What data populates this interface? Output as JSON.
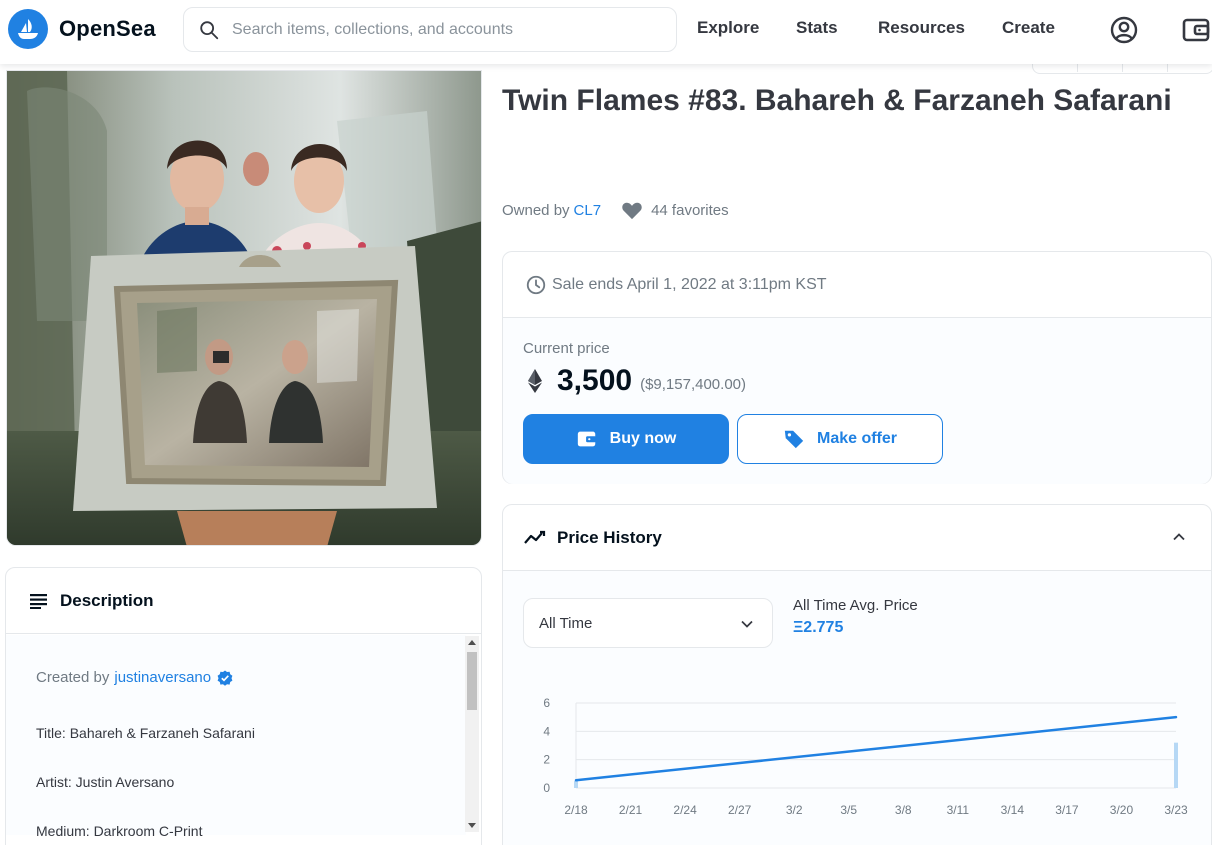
{
  "nav": {
    "brand": "OpenSea",
    "search_placeholder": "Search items, collections, and accounts",
    "links": [
      "Explore",
      "Stats",
      "Resources",
      "Create"
    ]
  },
  "item": {
    "title": "Twin Flames #83. Bahareh & Farzaneh Safarani",
    "owned_by_label": "Owned by",
    "owner": "CL7",
    "favorites": "44 favorites"
  },
  "sale": {
    "ends_text": "Sale ends April 1, 2022 at 3:11pm KST",
    "current_price_label": "Current price",
    "price": "3,500",
    "price_usd": "($9,157,400.00)",
    "buy_label": "Buy now",
    "offer_label": "Make offer"
  },
  "description": {
    "header": "Description",
    "created_by_label": "Created by",
    "creator": "justinaversano",
    "lines": [
      "Title: Bahareh & Farzaneh Safarani",
      "Artist: Justin Aversano",
      "Medium: Darkroom C-Print"
    ]
  },
  "price_history": {
    "header": "Price History",
    "range_selected": "All Time",
    "avg_label": "All Time Avg. Price",
    "avg_value": "Ξ2.775"
  },
  "chart_data": {
    "type": "line",
    "x": [
      "2/18",
      "3/23"
    ],
    "y": [
      0.55,
      5.0
    ],
    "volume": [
      0.5,
      3.2
    ],
    "xticks": [
      "2/18",
      "2/21",
      "2/24",
      "2/27",
      "3/2",
      "3/5",
      "3/8",
      "3/11",
      "3/14",
      "3/17",
      "3/20",
      "3/23"
    ],
    "yticks": [
      0,
      2,
      4,
      6
    ],
    "ylim": [
      0,
      6
    ],
    "grid": true,
    "line_color": "#2081e2",
    "volume_color": "#b6d8f5"
  },
  "colors": {
    "accent": "#2081e2",
    "text": "#353840",
    "muted": "#707a83",
    "border": "#e5e8eb"
  }
}
